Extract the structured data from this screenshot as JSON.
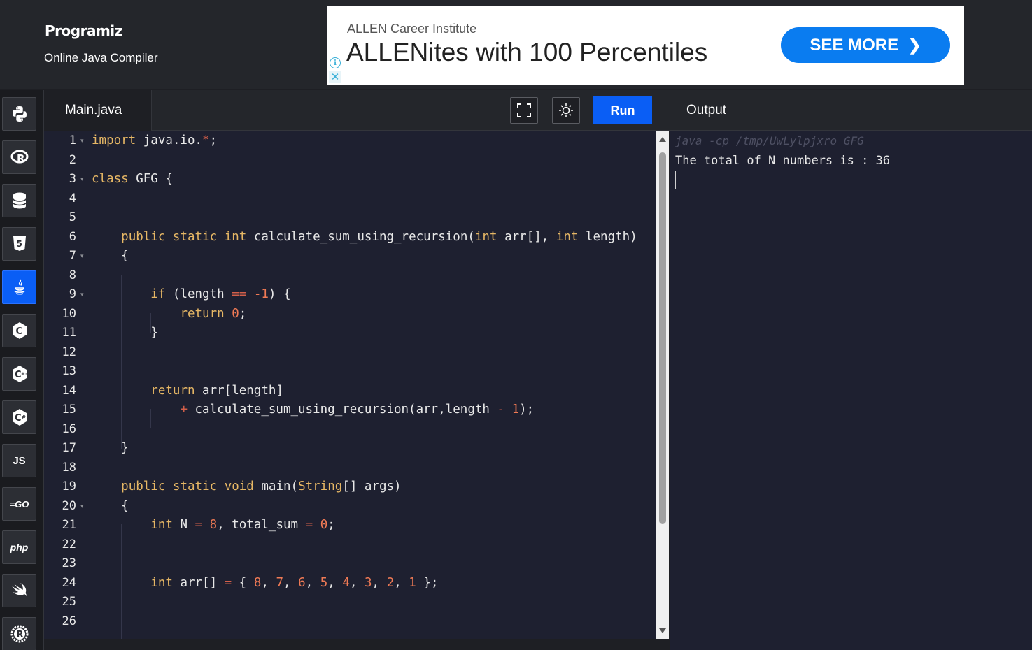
{
  "header": {
    "logo": "Programiz",
    "subtitle": "Online Java Compiler"
  },
  "ad": {
    "brand": "ALLEN Career Institute",
    "headline": "ALLENites with 100 Percentiles",
    "cta_label": "SEE MORE",
    "cta_color": "#0a7cf0"
  },
  "languages": [
    {
      "name": "python",
      "label": "",
      "active": false
    },
    {
      "name": "r",
      "label": "R",
      "active": false
    },
    {
      "name": "sql",
      "label": "",
      "active": false
    },
    {
      "name": "html",
      "label": "5",
      "active": false
    },
    {
      "name": "java",
      "label": "",
      "active": true
    },
    {
      "name": "c",
      "label": "C",
      "active": false
    },
    {
      "name": "cpp",
      "label": "C",
      "active": false
    },
    {
      "name": "csharp",
      "label": "C",
      "active": false
    },
    {
      "name": "js",
      "label": "JS",
      "active": false
    },
    {
      "name": "go",
      "label": "GO",
      "active": false
    },
    {
      "name": "php",
      "label": "php",
      "active": false
    },
    {
      "name": "swift",
      "label": "",
      "active": false
    },
    {
      "name": "rust",
      "label": "R",
      "active": false
    }
  ],
  "editor": {
    "tab_label": "Main.java",
    "run_label": "Run",
    "accent": "#0a5ef5",
    "line_numbers": [
      "1",
      "2",
      "3",
      "4",
      "5",
      "6",
      "7",
      "8",
      "9",
      "10",
      "11",
      "12",
      "13",
      "14",
      "15",
      "16",
      "17",
      "18",
      "19",
      "20",
      "21",
      "22",
      "23",
      "24",
      "25",
      "26"
    ],
    "fold_markers": [
      "1",
      "3",
      "7",
      "9",
      "20"
    ]
  },
  "output": {
    "title": "Output",
    "command": "java -cp /tmp/UwLylpjxro GFG",
    "result": "The total of N numbers is : 36"
  }
}
